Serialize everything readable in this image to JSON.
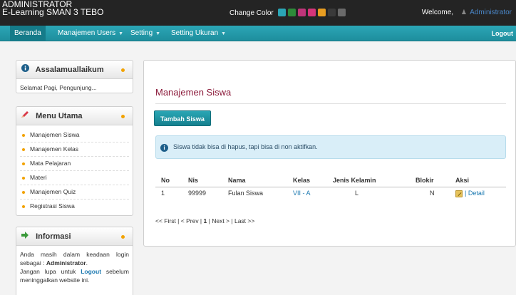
{
  "header": {
    "brand_line1": "ADMINISTRATOR",
    "brand_line2": "E-Learning SMAN 3 TEBO",
    "change_color_label": "Change Color",
    "swatches": [
      "#2ba6b6",
      "#2e8b3a",
      "#c0357a",
      "#d6357a",
      "#e89d21",
      "#3a3a3a",
      "#6a6a6a"
    ],
    "welcome_label": "Welcome,",
    "username": "Administrator"
  },
  "nav": {
    "items": [
      {
        "label": "Beranda",
        "dropdown": false
      },
      {
        "label": "Manajemen Users",
        "dropdown": true
      },
      {
        "label": "Setting",
        "dropdown": true
      },
      {
        "label": "Setting Ukuran",
        "dropdown": true
      }
    ],
    "logout": "Logout"
  },
  "sidebar": {
    "greeting_box": {
      "title": "Assalamuallaikum",
      "text": "Selamat Pagi, Pengunjung..."
    },
    "menu_box": {
      "title": "Menu Utama",
      "items": [
        "Manajemen Siswa",
        "Manajemen Kelas",
        "Mata Pelajaran",
        "Materi",
        "Manajemen Quiz",
        "Registrasi Siswa"
      ]
    },
    "info_box": {
      "title": "Informasi",
      "line1_a": "Anda  masih  dalam  keadaan  login sebagai : ",
      "line1_user": "Administrator",
      "line1_end": ".",
      "line2_a": "Jangan  lupa  untuk ",
      "line2_link": "Logout",
      "line2_b": "  sebelum meninggalkan website ini."
    }
  },
  "main": {
    "title": "Manajemen Siswa",
    "add_button": "Tambah Siswa",
    "alert_text": "Siswa tidak bisa di hapus, tapi bisa di non aktifkan.",
    "table": {
      "headers": [
        "No",
        "Nis",
        "Nama",
        "Kelas",
        "Jenis Kelamin",
        "Blokir",
        "Aksi"
      ],
      "rows": [
        {
          "no": "1",
          "nis": "99999",
          "nama": "Fulan Siswa",
          "kelas": "VII - A",
          "jk": "L",
          "blokir": "N",
          "aksi_detail": "| Detail"
        }
      ]
    },
    "pager": {
      "first": "<< First |",
      "prev": "< Prev |",
      "current": "1",
      "sep": "|",
      "next": "Next > |",
      "last": "Last >>"
    }
  }
}
